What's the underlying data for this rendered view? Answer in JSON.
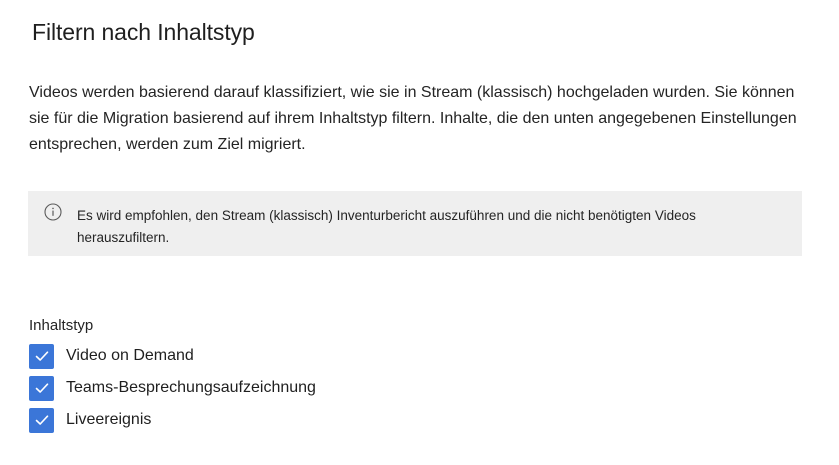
{
  "page": {
    "title": "Filtern nach Inhaltstyp",
    "description": "Videos werden basierend darauf klassifiziert, wie sie in Stream (klassisch) hochgeladen wurden. Sie können sie für die Migration basierend auf ihrem Inhaltstyp filtern. Inhalte, die den unten angegebenen Einstellungen entsprechen, werden zum Ziel migriert."
  },
  "info_box": {
    "icon": "info-icon",
    "text": "Es wird empfohlen, den Stream (klassisch) Inventurbericht auszuführen und die nicht benötigten Videos herauszufiltern."
  },
  "content_type": {
    "label": "Inhaltstyp",
    "options": [
      {
        "label": "Video on Demand",
        "checked": true
      },
      {
        "label": "Teams-Besprechungsaufzeichnung",
        "checked": true
      },
      {
        "label": "Liveereignis",
        "checked": true
      }
    ]
  },
  "colors": {
    "accent": "#3b76d8",
    "info_background": "#efefef"
  }
}
